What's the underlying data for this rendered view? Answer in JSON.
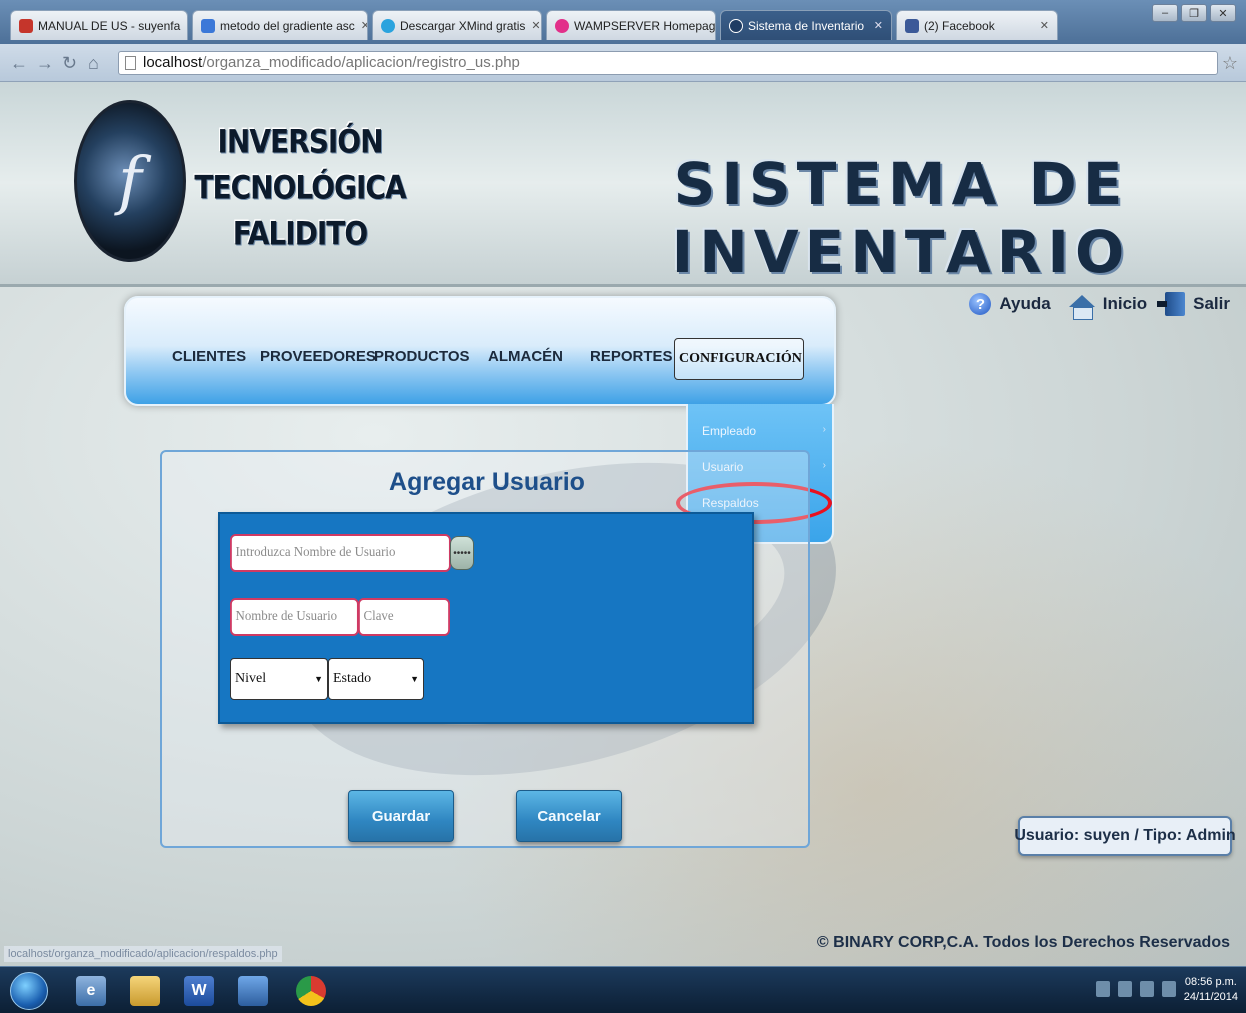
{
  "browser": {
    "tabs": [
      {
        "label": "MANUAL DE US - suyenfa",
        "favicon_color": "#c5352b",
        "active": false
      },
      {
        "label": "metodo del gradiente asc",
        "favicon_color": "#3b78d8",
        "active": false
      },
      {
        "label": "Descargar XMind gratis",
        "favicon_color": "#2aa3de",
        "active": false
      },
      {
        "label": "WAMPSERVER Homepage",
        "favicon_color": "#e2308a",
        "active": false
      },
      {
        "label": "Sistema de Inventario",
        "favicon_color": "#1f3c63",
        "active": true
      },
      {
        "label": "(2) Facebook",
        "favicon_color": "#3b5998",
        "active": false
      }
    ],
    "url_host": "localhost",
    "url_path": "/organza_modificado/aplicacion/registro_us.php"
  },
  "header": {
    "brand_line1": "INVERSIÓN TECNOLÓGICA",
    "brand_line2": "FALIDITO",
    "logo_glyph": "f",
    "system_title": "SISTEMA DE INVENTARIO"
  },
  "top_links": [
    {
      "label": "Ayuda",
      "icon": "help-icon"
    },
    {
      "label": "Inicio",
      "icon": "home-icon"
    },
    {
      "label": "Salir",
      "icon": "exit-icon"
    }
  ],
  "nav": {
    "items": [
      "CLIENTES",
      "PROVEEDORES",
      "PRODUCTOS",
      "ALMACÉN",
      "REPORTES",
      "CONFIGURACIÓN"
    ],
    "submenu": [
      "Empleado",
      "Usuario",
      "Respaldos"
    ]
  },
  "form": {
    "title": "Agregar Usuario",
    "search_placeholder": "Introduzca Nombre de Usuario",
    "search_btn_label": "•••••",
    "username_placeholder": "Nombre de Usuario",
    "password_placeholder": "Clave",
    "nivel_value": "Nivel",
    "estado_value": "Estado",
    "save_label": "Guardar",
    "cancel_label": "Cancelar"
  },
  "user_info": "Usuario: suyen / Tipo: Admin",
  "footer": "© BINARY CORP,C.A. Todos los Derechos Reservados",
  "status_url": "localhost/organza_modificado/aplicacion/respaldos.php",
  "taskbar": {
    "time": "08:56 p.m.",
    "date": "24/11/2014",
    "word_label": "W"
  },
  "colors": {
    "highlight_oval": "#e8101f",
    "accent_blue": "#1676c2"
  }
}
